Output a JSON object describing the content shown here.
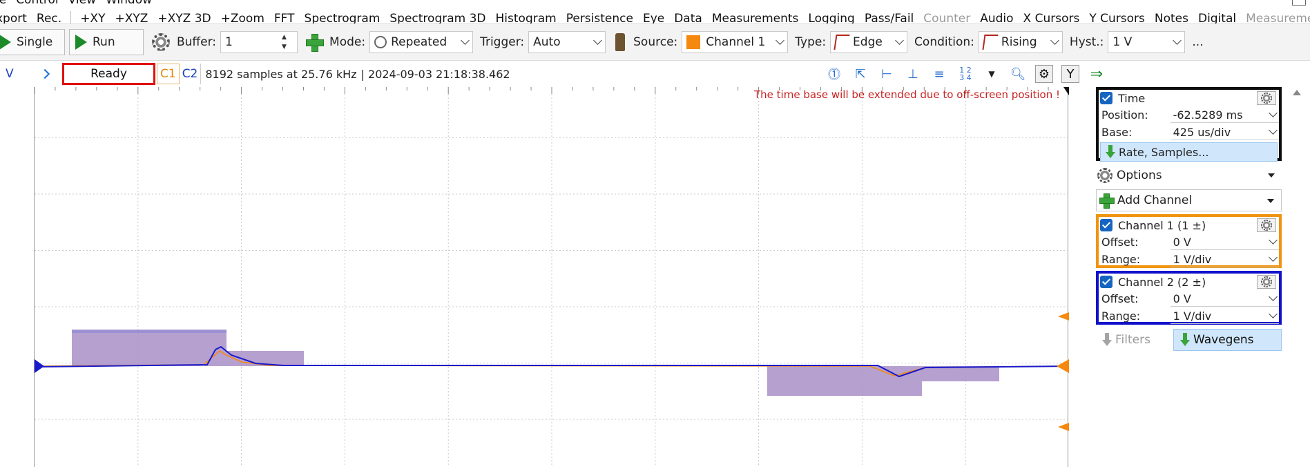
{
  "menu": {
    "items": [
      "le",
      "Control",
      "View",
      "Window"
    ]
  },
  "submenu": {
    "items": [
      {
        "label": "xport",
        "disabled": false
      },
      {
        "label": "Rec.",
        "disabled": false
      },
      {
        "label": "+XY",
        "disabled": false
      },
      {
        "label": "+XYZ",
        "disabled": false
      },
      {
        "label": "+XYZ 3D",
        "disabled": false
      },
      {
        "label": "+Zoom",
        "disabled": false
      },
      {
        "label": "FFT",
        "disabled": false
      },
      {
        "label": "Spectrogram",
        "disabled": false
      },
      {
        "label": "Spectrogram 3D",
        "disabled": false
      },
      {
        "label": "Histogram",
        "disabled": false
      },
      {
        "label": "Persistence",
        "disabled": false
      },
      {
        "label": "Eye",
        "disabled": false
      },
      {
        "label": "Data",
        "disabled": false
      },
      {
        "label": "Measurements",
        "disabled": false
      },
      {
        "label": "Logging",
        "disabled": false
      },
      {
        "label": "Pass/Fail",
        "disabled": false
      },
      {
        "label": "Counter",
        "disabled": true
      },
      {
        "label": "Audio",
        "disabled": false
      },
      {
        "label": "X Cursors",
        "disabled": false
      },
      {
        "label": "Y Cursors",
        "disabled": false
      },
      {
        "label": "Notes",
        "disabled": false
      },
      {
        "label": "Digital",
        "disabled": false
      },
      {
        "label": "Measurements",
        "disabled": true
      }
    ]
  },
  "toolbar": {
    "single_label": "Single",
    "run_label": "Run",
    "buffer_label": "Buffer:",
    "buffer_value": "1",
    "mode_label": "Mode:",
    "mode_value": "Repeated",
    "trigger_label": "Trigger:",
    "trigger_value": "Auto",
    "source_label": "Source:",
    "source_value": "Channel 1",
    "type_label": "Type:",
    "type_value": "Edge",
    "condition_label": "Condition:",
    "condition_value": "Rising",
    "hyst_label": "Hyst.:",
    "hyst_value": "1 V",
    "more_label": "..."
  },
  "status": {
    "v_label": "V",
    "state": "Ready",
    "c1": "C1",
    "c2": "C2",
    "info": "8192 samples at 25.76 kHz",
    "timestamp": "| 2024-09-03 21:18:38.462",
    "tool_y": "Y",
    "tool_numbers": "1 2\n3 4"
  },
  "plot": {
    "warning": "The time base will be extended due to off-screen position !",
    "colors": {
      "channel1": "#f5890f",
      "channel2": "#1a1acc",
      "wavegen_fill": "#a98fc7",
      "grid": "#c8c8c8"
    }
  },
  "panel": {
    "time": {
      "title": "Time",
      "position_label": "Position:",
      "position_value": "-62.5289 ms",
      "base_label": "Base:",
      "base_value": "425 us/div",
      "rate_button": "Rate, Samples..."
    },
    "options_label": "Options",
    "add_channel_label": "Add Channel",
    "channel1": {
      "title": "Channel 1 (1 ±)",
      "offset_label": "Offset:",
      "offset_value": "0 V",
      "range_label": "Range:",
      "range_value": "1 V/div"
    },
    "channel2": {
      "title": "Channel 2 (2 ±)",
      "offset_label": "Offset:",
      "offset_value": "0 V",
      "range_label": "Range:",
      "range_value": "1 V/div"
    },
    "filters_label": "Filters",
    "wavegens_label": "Wavegens"
  }
}
